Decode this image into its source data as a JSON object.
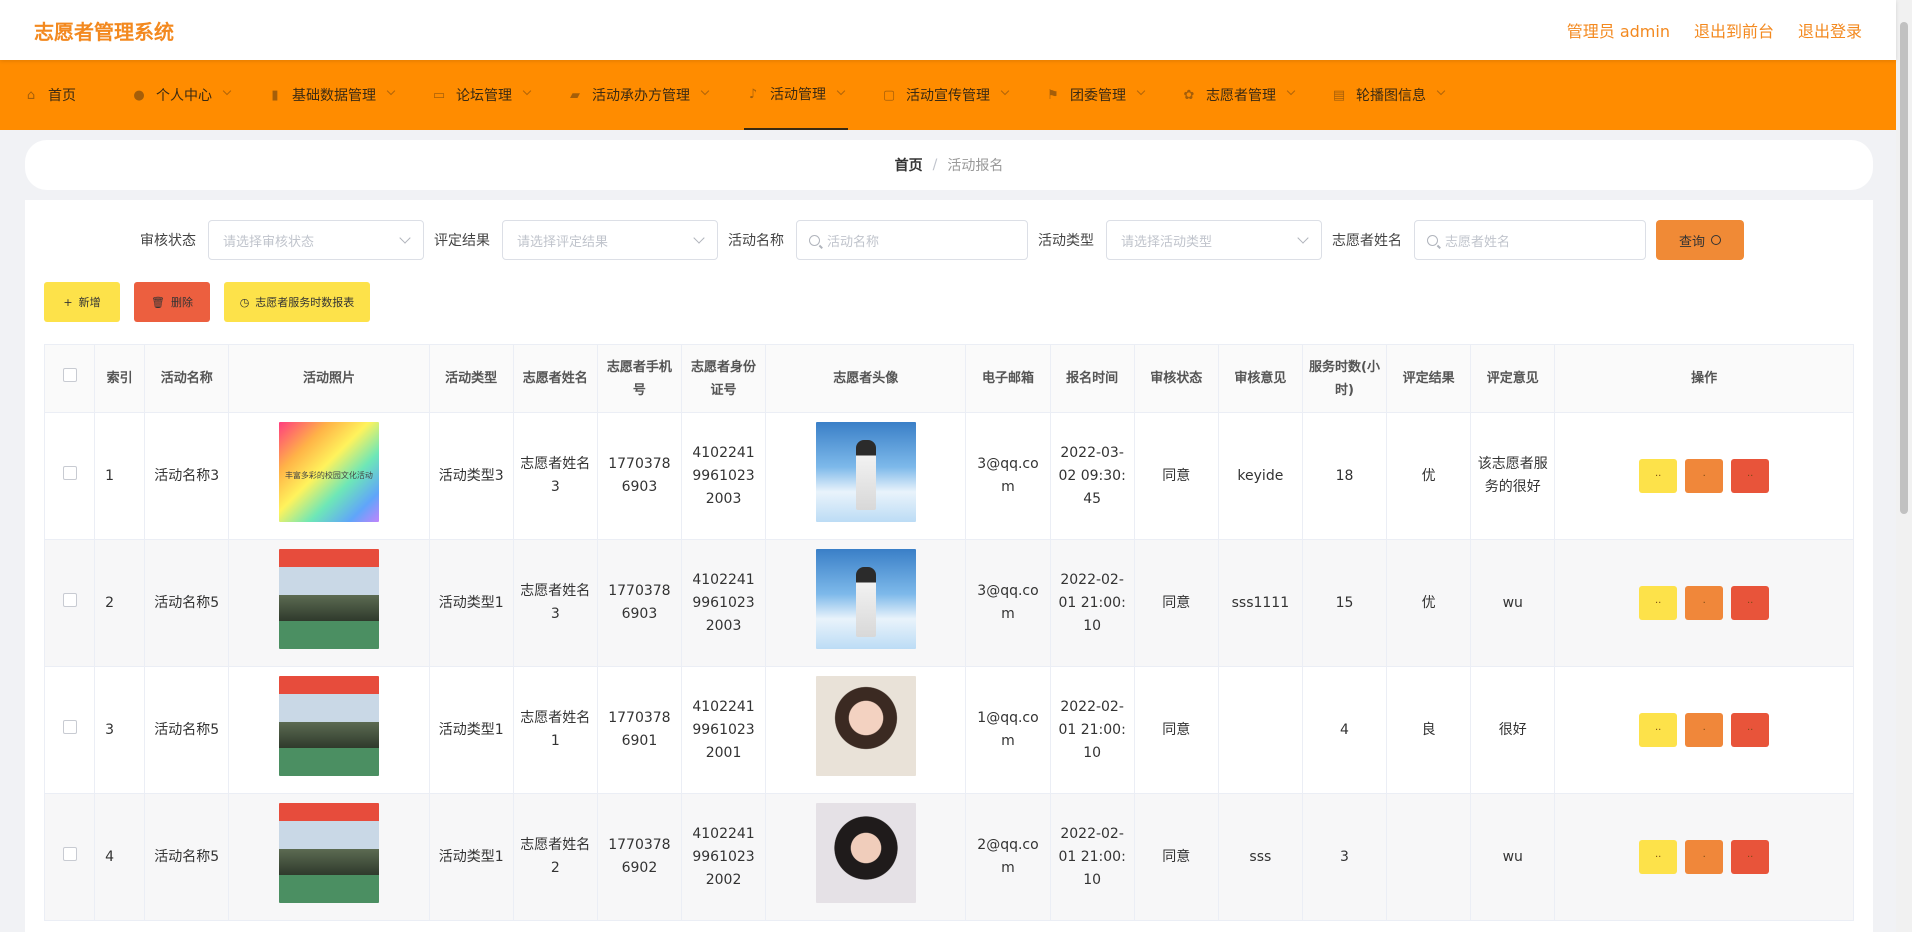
{
  "header": {
    "app_title": "志愿者管理系统",
    "admin_label": "管理员 admin",
    "frontend_link": "退出到前台",
    "logout_link": "退出登录"
  },
  "nav": {
    "items": [
      {
        "label": "首页",
        "icon": "home-icon"
      },
      {
        "label": "个人中心",
        "icon": "user-icon"
      },
      {
        "label": "基础数据管理",
        "icon": "chart-icon"
      },
      {
        "label": "论坛管理",
        "icon": "chat-icon"
      },
      {
        "label": "活动承办方管理",
        "icon": "briefcase-icon"
      },
      {
        "label": "活动管理",
        "icon": "mic-icon"
      },
      {
        "label": "活动宣传管理",
        "icon": "frame-icon"
      },
      {
        "label": "团委管理",
        "icon": "flag-icon"
      },
      {
        "label": "志愿者管理",
        "icon": "settings-icon"
      },
      {
        "label": "轮播图信息",
        "icon": "clipboard-icon"
      }
    ],
    "active_index": 5
  },
  "breadcrumb": {
    "home": "首页",
    "separator": "/",
    "current": "活动报名"
  },
  "filters": {
    "status_label": "审核状态",
    "status_placeholder": "请选择审核状态",
    "result_label": "评定结果",
    "result_placeholder": "请选择评定结果",
    "name_label": "活动名称",
    "name_placeholder": "活动名称",
    "type_label": "活动类型",
    "type_placeholder": "请选择活动类型",
    "volunteer_label": "志愿者姓名",
    "volunteer_placeholder": "志愿者姓名",
    "query_button": "查询"
  },
  "actions": {
    "add": "新增",
    "delete": "删除",
    "report": "志愿者服务时数报表"
  },
  "table": {
    "headers": [
      "索引",
      "活动名称",
      "活动照片",
      "活动类型",
      "志愿者姓名",
      "志愿者手机号",
      "志愿者身份证号",
      "志愿者头像",
      "电子邮箱",
      "报名时间",
      "审核状态",
      "审核意见",
      "服务时数(小时)",
      "评定结果",
      "评定意见",
      "操作"
    ],
    "rows": [
      {
        "index": "1",
        "activity": "活动名称3",
        "photo": "rainbow",
        "photo_caption": "丰富多彩的校园文化活动",
        "type": "活动类型3",
        "volunteer": "志愿者姓名3",
        "phone": "17703786903",
        "idcard": "410224199610232003",
        "avatar": "boy",
        "email": "3@qq.com",
        "signup_time": "2022-03-02 09:30:45",
        "status": "同意",
        "opinion": "keyide",
        "hours": "18",
        "result": "优",
        "evaluation": "该志愿者服务的很好"
      },
      {
        "index": "2",
        "activity": "活动名称5",
        "photo": "event",
        "type": "活动类型1",
        "volunteer": "志愿者姓名3",
        "phone": "17703786903",
        "idcard": "410224199610232003",
        "avatar": "boy",
        "email": "3@qq.com",
        "signup_time": "2022-02-01 21:00:10",
        "status": "同意",
        "opinion": "sss1111",
        "hours": "15",
        "result": "优",
        "evaluation": "wu"
      },
      {
        "index": "3",
        "activity": "活动名称5",
        "photo": "event",
        "type": "活动类型1",
        "volunteer": "志愿者姓名1",
        "phone": "17703786901",
        "idcard": "410224199610232001",
        "avatar": "girl1",
        "email": "1@qq.com",
        "signup_time": "2022-02-01 21:00:10",
        "status": "同意",
        "opinion": "",
        "hours": "4",
        "result": "良",
        "evaluation": "很好"
      },
      {
        "index": "4",
        "activity": "活动名称5",
        "photo": "event",
        "type": "活动类型1",
        "volunteer": "志愿者姓名2",
        "phone": "17703786902",
        "idcard": "410224199610232002",
        "avatar": "girl2",
        "email": "2@qq.com",
        "signup_time": "2022-02-01 21:00:10",
        "status": "同意",
        "opinion": "sss",
        "hours": "3",
        "result": "",
        "evaluation": "wu"
      }
    ],
    "op_buttons": [
      "··",
      "·",
      "··"
    ]
  },
  "colors": {
    "accent": "#ff8c00",
    "brand_text": "#f3891f",
    "btn_yellow": "#fde24a",
    "btn_orange": "#f0873a",
    "btn_red": "#e8543a"
  }
}
